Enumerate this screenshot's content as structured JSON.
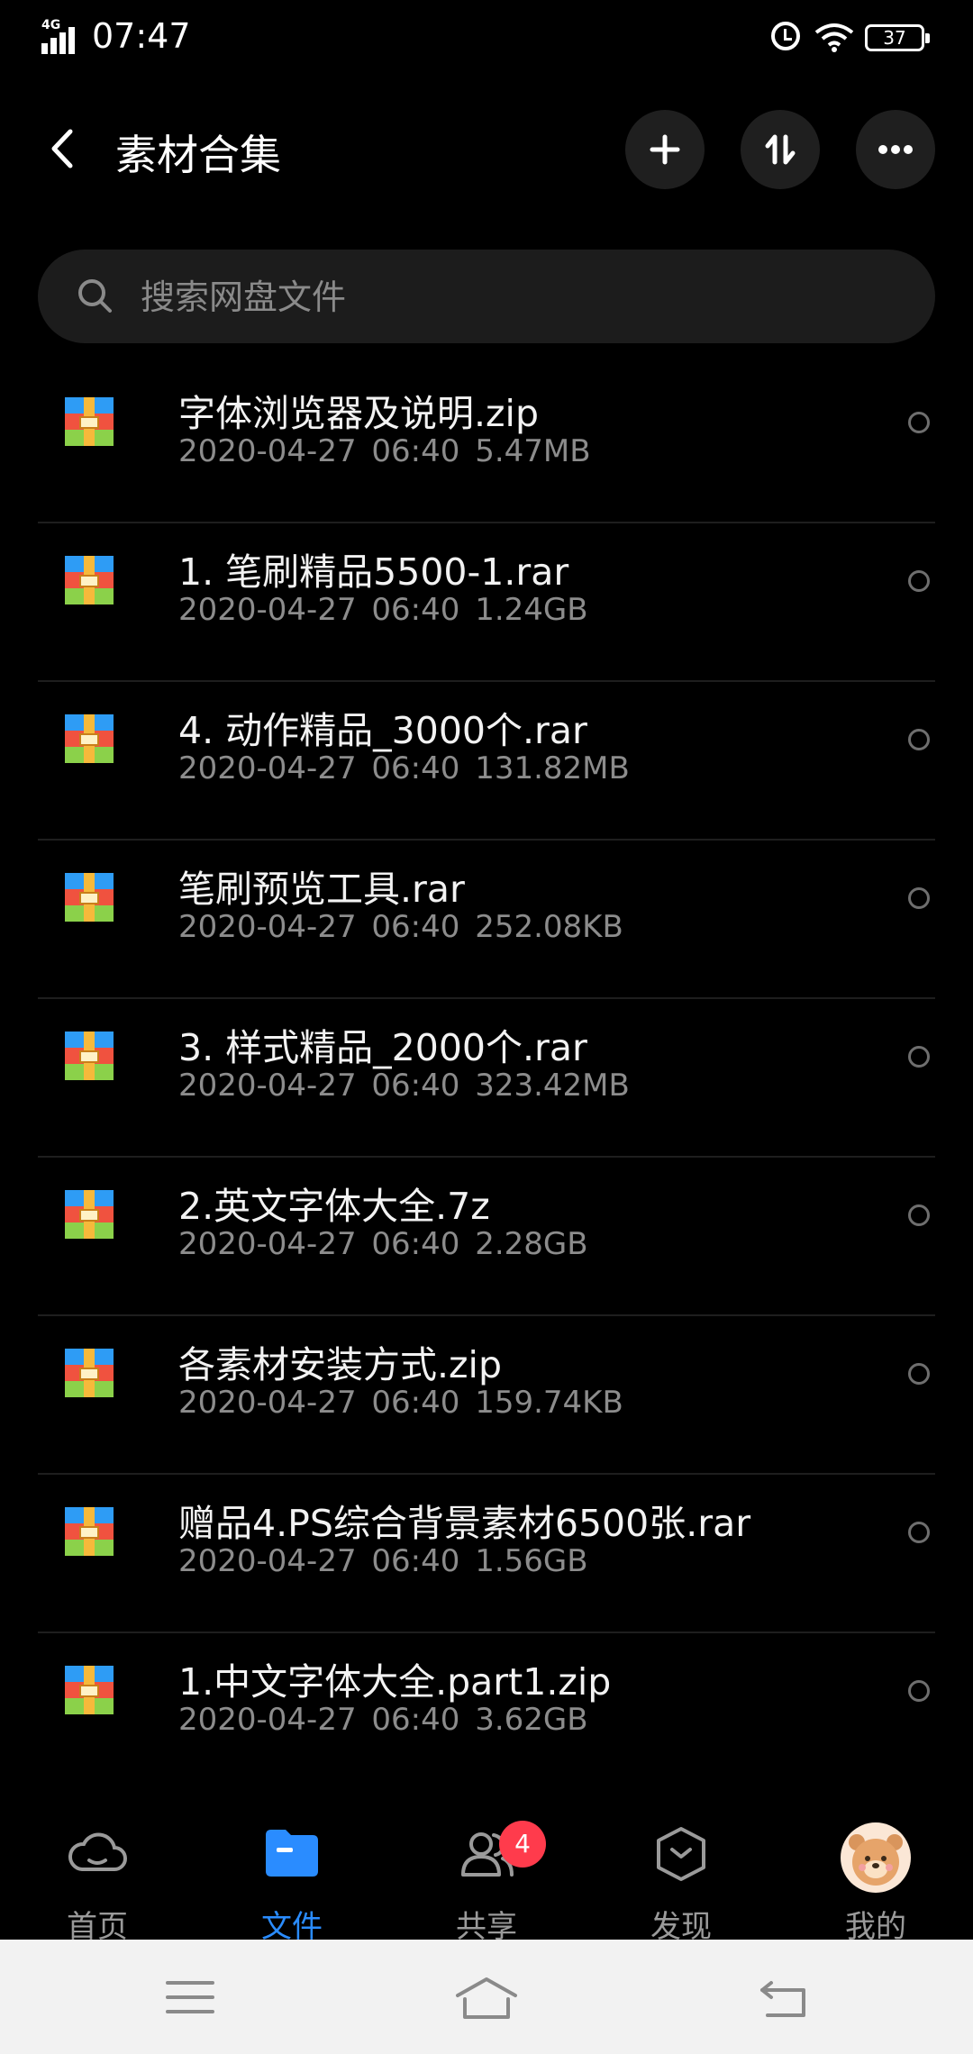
{
  "status_bar": {
    "network": "4G",
    "time": "07:47",
    "battery": "37"
  },
  "header": {
    "title": "素材合集"
  },
  "search": {
    "placeholder": "搜索网盘文件"
  },
  "files": [
    {
      "name": "字体浏览器及说明.zip",
      "date": "2020-04-27",
      "time": "06:40",
      "size": "5.47MB"
    },
    {
      "name": "1. 笔刷精品5500-1.rar",
      "date": "2020-04-27",
      "time": "06:40",
      "size": "1.24GB"
    },
    {
      "name": "4. 动作精品_3000个.rar",
      "date": "2020-04-27",
      "time": "06:40",
      "size": "131.82MB"
    },
    {
      "name": "笔刷预览工具.rar",
      "date": "2020-04-27",
      "time": "06:40",
      "size": "252.08KB"
    },
    {
      "name": "3. 样式精品_2000个.rar",
      "date": "2020-04-27",
      "time": "06:40",
      "size": "323.42MB"
    },
    {
      "name": "2.英文字体大全.7z",
      "date": "2020-04-27",
      "time": "06:40",
      "size": "2.28GB"
    },
    {
      "name": "各素材安装方式.zip",
      "date": "2020-04-27",
      "time": "06:40",
      "size": "159.74KB"
    },
    {
      "name": "赠品4.PS综合背景素材6500张.rar",
      "date": "2020-04-27",
      "time": "06:40",
      "size": "1.56GB"
    },
    {
      "name": "1.中文字体大全.part1.zip",
      "date": "2020-04-27",
      "time": "06:40",
      "size": "3.62GB"
    }
  ],
  "tabs": [
    {
      "label": "首页",
      "icon": "cloud-icon",
      "active": false
    },
    {
      "label": "文件",
      "icon": "folder-icon",
      "active": true
    },
    {
      "label": "共享",
      "icon": "users-icon",
      "active": false,
      "badge": "4"
    },
    {
      "label": "发现",
      "icon": "discover-icon",
      "active": false
    },
    {
      "label": "我的",
      "icon": "avatar",
      "active": false
    }
  ],
  "colors": {
    "accent": "#2a8cff",
    "badge": "#ff3b4c",
    "background": "#000000"
  }
}
